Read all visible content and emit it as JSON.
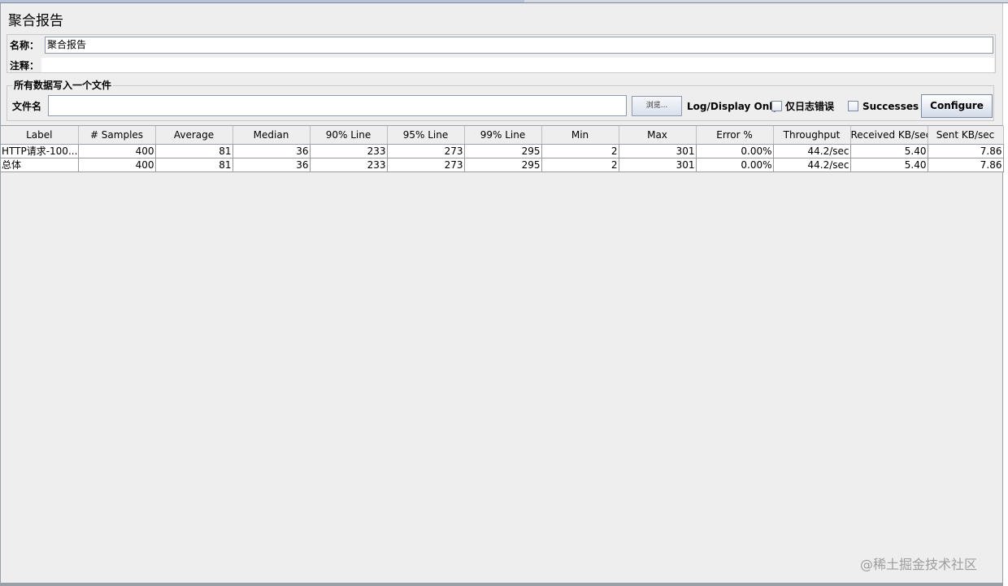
{
  "window": {
    "title": "聚合报告"
  },
  "name_section": {
    "name_label": "名称：",
    "name_value": "聚合报告",
    "comment_label": "注释："
  },
  "file_section": {
    "legend": "所有数据写入一个文件",
    "filename_label": "文件名",
    "filename_value": "",
    "browse_label": "浏览...",
    "log_display_label": "Log/Display Only:",
    "errors_only_label": "仅日志错误",
    "errors_only_checked": false,
    "successes_label": "Successes",
    "successes_checked": false,
    "configure_label": "Configure"
  },
  "table": {
    "columns": [
      "Label",
      "# Samples",
      "Average",
      "Median",
      "90% Line",
      "95% Line",
      "99% Line",
      "Min",
      "Max",
      "Error %",
      "Throughput",
      "Received KB/sec",
      "Sent KB/sec"
    ],
    "rows": [
      [
        "HTTP请求-100...",
        "400",
        "81",
        "36",
        "233",
        "273",
        "295",
        "2",
        "301",
        "0.00%",
        "44.2/sec",
        "5.40",
        "7.86"
      ],
      [
        "总体",
        "400",
        "81",
        "36",
        "233",
        "273",
        "295",
        "2",
        "301",
        "0.00%",
        "44.2/sec",
        "5.40",
        "7.86"
      ]
    ]
  },
  "watermark": "@稀土掘金技术社区"
}
